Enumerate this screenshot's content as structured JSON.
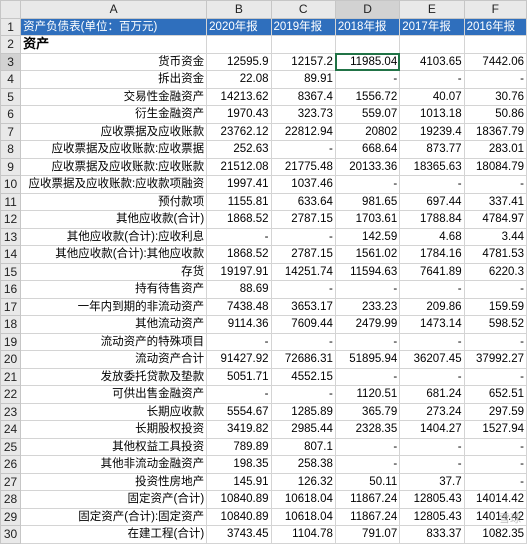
{
  "columns": [
    "A",
    "B",
    "C",
    "D",
    "E",
    "F"
  ],
  "header_row": {
    "num": "1",
    "cells": [
      "资产负债表(单位：百万元)",
      "2020年报",
      "2019年报",
      "2018年报",
      "2017年报",
      "2016年报"
    ]
  },
  "section_row": {
    "num": "2",
    "label": "资产"
  },
  "rows": [
    {
      "num": "3",
      "label": "货币资金",
      "values": [
        "12595.9",
        "12157.2",
        "11985.04",
        "4103.65",
        "7442.06"
      ]
    },
    {
      "num": "4",
      "label": "拆出资金",
      "values": [
        "22.08",
        "89.91",
        "-",
        "-",
        "-"
      ]
    },
    {
      "num": "5",
      "label": "交易性金融资产",
      "values": [
        "14213.62",
        "8367.4",
        "1556.72",
        "40.07",
        "30.76"
      ]
    },
    {
      "num": "6",
      "label": "衍生金融资产",
      "values": [
        "1970.43",
        "323.73",
        "559.07",
        "1013.18",
        "50.86"
      ]
    },
    {
      "num": "7",
      "label": "应收票据及应收账款",
      "values": [
        "23762.12",
        "22812.94",
        "20802",
        "19239.4",
        "18367.79"
      ]
    },
    {
      "num": "8",
      "label": "应收票据及应收账款:应收票据",
      "values": [
        "252.63",
        "-",
        "668.64",
        "873.77",
        "283.01"
      ]
    },
    {
      "num": "9",
      "label": "应收票据及应收账款:应收账款",
      "values": [
        "21512.08",
        "21775.48",
        "20133.36",
        "18365.63",
        "18084.79"
      ]
    },
    {
      "num": "10",
      "label": "应收票据及应收账款:应收款项融资",
      "values": [
        "1997.41",
        "1037.46",
        "-",
        "-",
        "-"
      ]
    },
    {
      "num": "11",
      "label": "预付款项",
      "values": [
        "1155.81",
        "633.64",
        "981.65",
        "697.44",
        "337.41"
      ]
    },
    {
      "num": "12",
      "label": "其他应收款(合计)",
      "values": [
        "1868.52",
        "2787.15",
        "1703.61",
        "1788.84",
        "4784.97"
      ]
    },
    {
      "num": "13",
      "label": "其他应收款(合计):应收利息",
      "values": [
        "-",
        "-",
        "142.59",
        "4.68",
        "3.44"
      ]
    },
    {
      "num": "14",
      "label": "其他应收款(合计):其他应收款",
      "values": [
        "1868.52",
        "2787.15",
        "1561.02",
        "1784.16",
        "4781.53"
      ]
    },
    {
      "num": "15",
      "label": "存货",
      "values": [
        "19197.91",
        "14251.74",
        "11594.63",
        "7641.89",
        "6220.3"
      ]
    },
    {
      "num": "16",
      "label": "持有待售资产",
      "values": [
        "88.69",
        "-",
        "-",
        "-",
        "-"
      ]
    },
    {
      "num": "17",
      "label": "一年内到期的非流动资产",
      "values": [
        "7438.48",
        "3653.17",
        "233.23",
        "209.86",
        "159.59"
      ]
    },
    {
      "num": "18",
      "label": "其他流动资产",
      "values": [
        "9114.36",
        "7609.44",
        "2479.99",
        "1473.14",
        "598.52"
      ]
    },
    {
      "num": "19",
      "label": "流动资产的特殊项目",
      "values": [
        "-",
        "-",
        "-",
        "-",
        "-"
      ]
    },
    {
      "num": "20",
      "label": "流动资产合计",
      "values": [
        "91427.92",
        "72686.31",
        "51895.94",
        "36207.45",
        "37992.27"
      ]
    },
    {
      "num": "21",
      "label": "发放委托贷款及垫款",
      "values": [
        "5051.71",
        "4552.15",
        "-",
        "-",
        "-"
      ]
    },
    {
      "num": "22",
      "label": "可供出售金融资产",
      "values": [
        "-",
        "-",
        "1120.51",
        "681.24",
        "652.51"
      ]
    },
    {
      "num": "23",
      "label": "长期应收款",
      "values": [
        "5554.67",
        "1285.89",
        "365.79",
        "273.24",
        "297.59"
      ]
    },
    {
      "num": "24",
      "label": "长期股权投资",
      "values": [
        "3419.82",
        "2985.44",
        "2328.35",
        "1404.27",
        "1527.94"
      ]
    },
    {
      "num": "25",
      "label": "其他权益工具投资",
      "values": [
        "789.89",
        "807.1",
        "-",
        "-",
        "-"
      ]
    },
    {
      "num": "26",
      "label": "其他非流动金融资产",
      "values": [
        "198.35",
        "258.38",
        "-",
        "-",
        "-"
      ]
    },
    {
      "num": "27",
      "label": "投资性房地产",
      "values": [
        "145.91",
        "126.32",
        "50.11",
        "37.7",
        "-"
      ]
    },
    {
      "num": "28",
      "label": "固定资产(合计)",
      "values": [
        "10840.89",
        "10618.04",
        "11867.24",
        "12805.43",
        "14014.42"
      ]
    },
    {
      "num": "29",
      "label": "固定资产(合计):固定资产",
      "values": [
        "10840.89",
        "10618.04",
        "11867.24",
        "12805.43",
        "14014.42"
      ]
    },
    {
      "num": "30",
      "label": "在建工程(合计)",
      "values": [
        "3743.45",
        "1104.78",
        "791.07",
        "833.37",
        "1082.35"
      ]
    }
  ],
  "selected": {
    "row": "3",
    "column": "D"
  },
  "watermark": "雪球",
  "colors": {
    "header_fill": "#2f6fbd",
    "header_text": "#ffffff",
    "selection_border": "#217346"
  }
}
